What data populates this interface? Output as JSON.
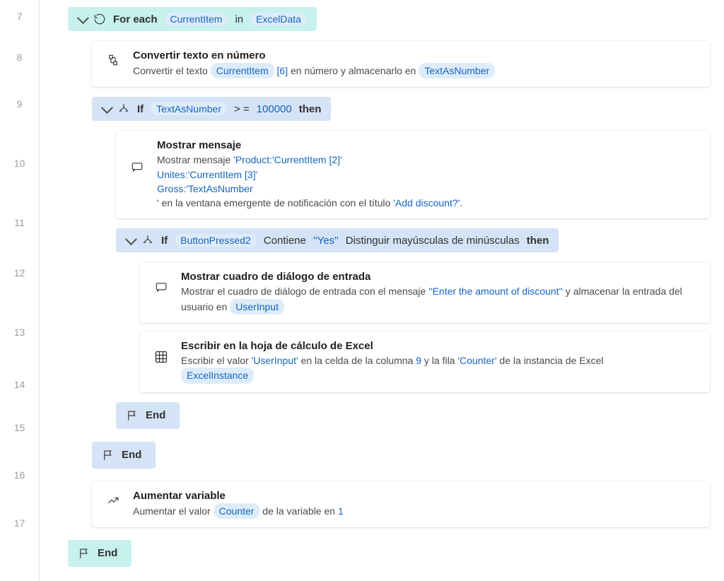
{
  "gutter": {
    "start": 7,
    "end": 17
  },
  "foreach": {
    "kw": "For each",
    "var": "CurrentItem",
    "in": "in",
    "src": "ExcelData"
  },
  "step8": {
    "title": "Convertir texto en número",
    "d1": "Convertir el texto ",
    "var": "CurrentItem",
    "idx": "[6]",
    "d2": " en número y almacenarlo en ",
    "out": "TextAsNumber"
  },
  "if9": {
    "kw": "If",
    "var": "TextAsNumber",
    "op": " > = ",
    "val": "100000",
    "then": "then"
  },
  "step10": {
    "title": "Mostrar mensaje",
    "d1": "Mostrar mensaje ",
    "m1": "'Product:'CurrentItem [2]'",
    "m2": "Unites:'CurrentItem [3]'",
    "m3": "Gross:'TextAsNumber",
    "d2": "' en la ventana emergente de notificación con el título ",
    "tquote": "'Add discount?'",
    "tdot": "."
  },
  "if11": {
    "kw": "If",
    "var": "ButtonPressed2",
    "op": " Contiene ",
    "val": "''Yes''",
    "rest": " Distinguir mayúsculas de minúsculas ",
    "then": "then"
  },
  "step12": {
    "title": "Mostrar cuadro de diálogo de entrada",
    "d1": "Mostrar el cuadro de diálogo de entrada con el mensaje ",
    "msg": "''Enter the amount of discount''",
    "d2": " y almacenar la entrada del usuario en ",
    "out": "UserInput"
  },
  "step13": {
    "title": "Escribir en la hoja de cálculo de Excel",
    "d1": "Escribir el valor ",
    "val": "'UserInput'",
    "d2": " en la celda de la columna ",
    "col": "9",
    "d3": " y la fila ",
    "row": "'Counter'",
    "d4": " de la instancia de Excel ",
    "inst": "ExcelInstance"
  },
  "end14": "End",
  "end15": "End",
  "step16": {
    "title": "Aumentar variable",
    "d1": "Aumentar el valor ",
    "var": "Counter",
    "d2": " de la variable en ",
    "val": "1"
  },
  "end17": "End"
}
